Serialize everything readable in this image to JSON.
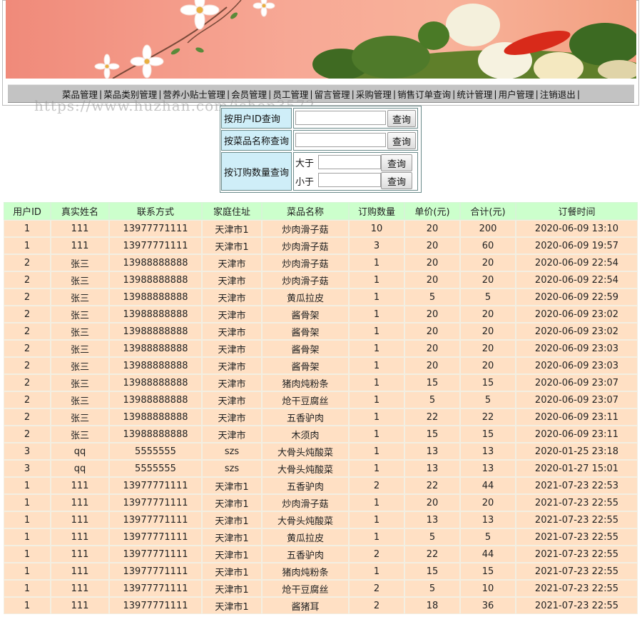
{
  "nav": {
    "items": [
      "菜品管理",
      "菜品类别管理",
      "营养小贴士管理",
      "会员管理",
      "员工管理",
      "留言管理",
      "采购管理",
      "销售订单查询",
      "统计管理",
      "用户管理",
      "注销退出"
    ],
    "separator": "|"
  },
  "watermark": "https://www.huzhan.com/ishop3572",
  "search": {
    "by_user_id_label": "按用户ID查询",
    "by_dish_name_label": "按菜品名称查询",
    "by_quantity_label": "按订购数量查询",
    "greater_label": "大于",
    "less_label": "小于",
    "query_button": "查询",
    "user_id_value": "",
    "dish_name_value": "",
    "greater_value": "",
    "less_value": ""
  },
  "table": {
    "headers": [
      "用户ID",
      "真实姓名",
      "联系方式",
      "家庭住址",
      "菜品名称",
      "订购数量",
      "单价(元)",
      "合计(元)",
      "订餐时间"
    ],
    "rows": [
      [
        "1",
        "111",
        "13977771111",
        "天津市1",
        "炒肉滑子菇",
        "10",
        "20",
        "200",
        "2020-06-09 13:10"
      ],
      [
        "1",
        "111",
        "13977771111",
        "天津市1",
        "炒肉滑子菇",
        "3",
        "20",
        "60",
        "2020-06-09 19:57"
      ],
      [
        "2",
        "张三",
        "13988888888",
        "天津市",
        "炒肉滑子菇",
        "1",
        "20",
        "20",
        "2020-06-09 22:54"
      ],
      [
        "2",
        "张三",
        "13988888888",
        "天津市",
        "炒肉滑子菇",
        "1",
        "20",
        "20",
        "2020-06-09 22:54"
      ],
      [
        "2",
        "张三",
        "13988888888",
        "天津市",
        "黄瓜拉皮",
        "1",
        "5",
        "5",
        "2020-06-09 22:59"
      ],
      [
        "2",
        "张三",
        "13988888888",
        "天津市",
        "酱骨架",
        "1",
        "20",
        "20",
        "2020-06-09 23:02"
      ],
      [
        "2",
        "张三",
        "13988888888",
        "天津市",
        "酱骨架",
        "1",
        "20",
        "20",
        "2020-06-09 23:02"
      ],
      [
        "2",
        "张三",
        "13988888888",
        "天津市",
        "酱骨架",
        "1",
        "20",
        "20",
        "2020-06-09 23:03"
      ],
      [
        "2",
        "张三",
        "13988888888",
        "天津市",
        "酱骨架",
        "1",
        "20",
        "20",
        "2020-06-09 23:03"
      ],
      [
        "2",
        "张三",
        "13988888888",
        "天津市",
        "猪肉炖粉条",
        "1",
        "15",
        "15",
        "2020-06-09 23:07"
      ],
      [
        "2",
        "张三",
        "13988888888",
        "天津市",
        "炝干豆腐丝",
        "1",
        "5",
        "5",
        "2020-06-09 23:07"
      ],
      [
        "2",
        "张三",
        "13988888888",
        "天津市",
        "五香驴肉",
        "1",
        "22",
        "22",
        "2020-06-09 23:11"
      ],
      [
        "2",
        "张三",
        "13988888888",
        "天津市",
        "木须肉",
        "1",
        "15",
        "15",
        "2020-06-09 23:11"
      ],
      [
        "3",
        "qq",
        "5555555",
        "szs",
        "大骨头炖酸菜",
        "1",
        "13",
        "13",
        "2020-01-25 23:18"
      ],
      [
        "3",
        "qq",
        "5555555",
        "szs",
        "大骨头炖酸菜",
        "1",
        "13",
        "13",
        "2020-01-27 15:01"
      ],
      [
        "1",
        "111",
        "13977771111",
        "天津市1",
        "五香驴肉",
        "2",
        "22",
        "44",
        "2021-07-23 22:53"
      ],
      [
        "1",
        "111",
        "13977771111",
        "天津市1",
        "炒肉滑子菇",
        "1",
        "20",
        "20",
        "2021-07-23 22:55"
      ],
      [
        "1",
        "111",
        "13977771111",
        "天津市1",
        "大骨头炖酸菜",
        "1",
        "13",
        "13",
        "2021-07-23 22:55"
      ],
      [
        "1",
        "111",
        "13977771111",
        "天津市1",
        "黄瓜拉皮",
        "1",
        "5",
        "5",
        "2021-07-23 22:55"
      ],
      [
        "1",
        "111",
        "13977771111",
        "天津市1",
        "五香驴肉",
        "2",
        "22",
        "44",
        "2021-07-23 22:55"
      ],
      [
        "1",
        "111",
        "13977771111",
        "天津市1",
        "猪肉炖粉条",
        "1",
        "15",
        "15",
        "2021-07-23 22:55"
      ],
      [
        "1",
        "111",
        "13977771111",
        "天津市1",
        "炝干豆腐丝",
        "2",
        "5",
        "10",
        "2021-07-23 22:55"
      ],
      [
        "1",
        "111",
        "13977771111",
        "天津市1",
        "酱猪耳",
        "2",
        "18",
        "36",
        "2021-07-23 22:55"
      ]
    ]
  }
}
